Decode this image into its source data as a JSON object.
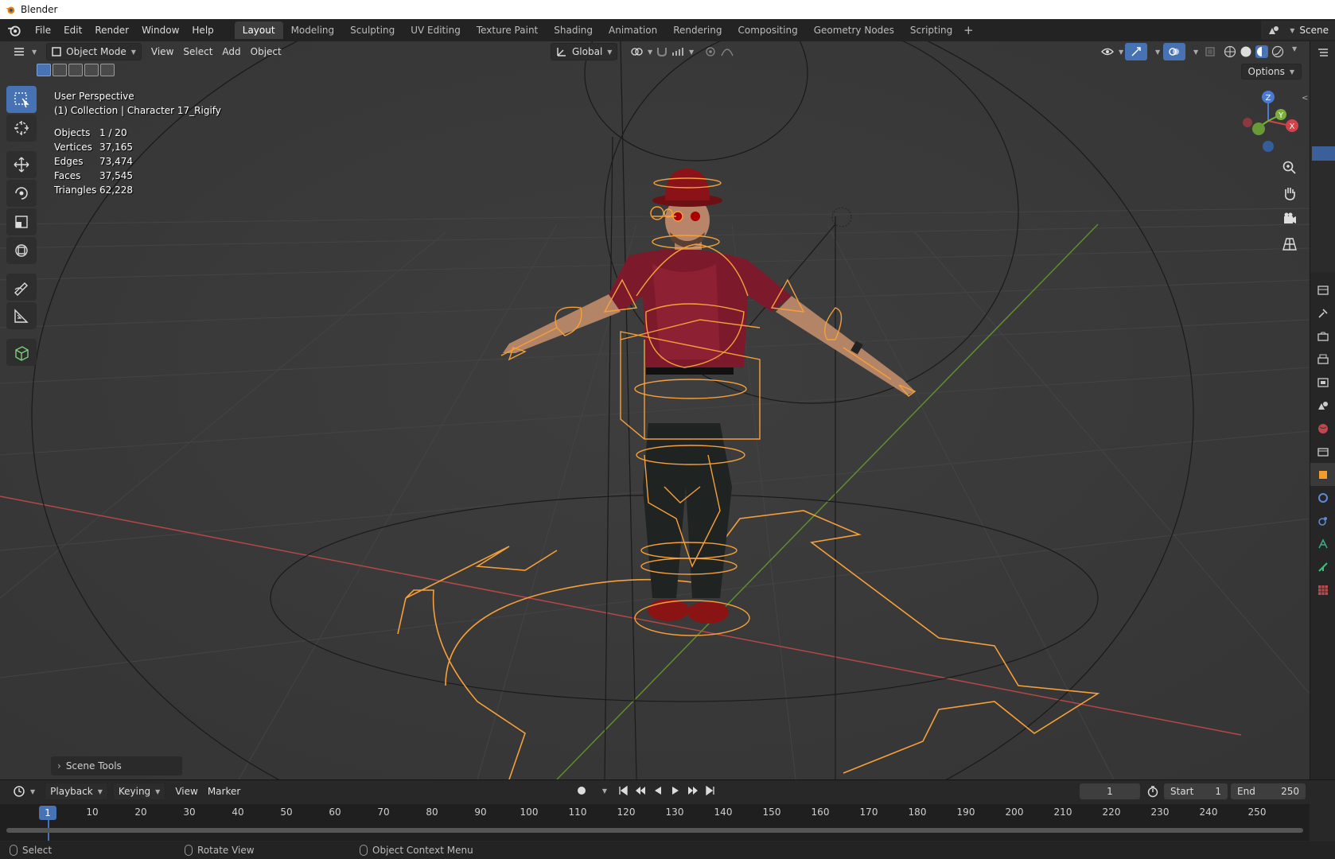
{
  "app": {
    "window_title": "Blender"
  },
  "menu": [
    "File",
    "Edit",
    "Render",
    "Window",
    "Help"
  ],
  "workspaces": [
    "Layout",
    "Modeling",
    "Sculpting",
    "UV Editing",
    "Texture Paint",
    "Shading",
    "Animation",
    "Rendering",
    "Compositing",
    "Geometry Nodes",
    "Scripting"
  ],
  "active_workspace": "Layout",
  "scene": {
    "name": "Scene"
  },
  "viewport_header": {
    "mode": "Object Mode",
    "menus": [
      "View",
      "Select",
      "Add",
      "Object"
    ],
    "transform_orientation": "Global",
    "options_label": "Options"
  },
  "overlay": {
    "view_name": "User Perspective",
    "collection_line": "(1) Collection | Character 17_Rigify",
    "stats": [
      {
        "label": "Objects",
        "value": "1 / 20"
      },
      {
        "label": "Vertices",
        "value": "37,165"
      },
      {
        "label": "Edges",
        "value": "73,474"
      },
      {
        "label": "Faces",
        "value": "37,545"
      },
      {
        "label": "Triangles",
        "value": "62,228"
      }
    ]
  },
  "gizmo": {
    "x_label": "X",
    "y_label": "Y",
    "z_label": "Z"
  },
  "scene_tools_label": "Scene Tools",
  "timeline": {
    "menus": [
      "Playback",
      "Keying",
      "View",
      "Marker"
    ],
    "current_frame": "1",
    "start_label": "Start",
    "start_value": "1",
    "end_label": "End",
    "end_value": "250",
    "ticks": [
      "10",
      "20",
      "30",
      "40",
      "50",
      "60",
      "70",
      "80",
      "90",
      "100",
      "110",
      "120",
      "130",
      "140",
      "150",
      "160",
      "170",
      "180",
      "190",
      "200",
      "210",
      "220",
      "230",
      "240",
      "250"
    ]
  },
  "statusbar": {
    "select": "Select",
    "rotate": "Rotate View",
    "context": "Object Context Menu"
  },
  "colors": {
    "selection_accent": "#4772b3",
    "rig_outline": "#f5a03a",
    "x_axis": "#c24b4b",
    "y_axis": "#6fa13a"
  }
}
